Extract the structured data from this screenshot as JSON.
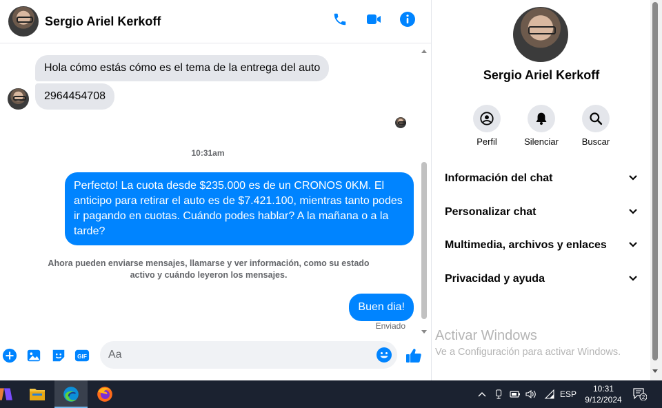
{
  "header": {
    "title": "Sergio Ariel Kerkoff"
  },
  "messages": {
    "incoming_1": "Hola cómo estás cómo es el tema de la entrega del auto",
    "incoming_2": "2964454708",
    "timestamp": "10:31am",
    "outgoing_1": "Perfecto! La cuota desde $235.000 es de un CRONOS 0KM. El anticipo para retirar el auto es de $7.421.100, mientras tanto podes ir pagando en cuotas. Cuándo podes hablar? A la mañana o a la tarde?",
    "notice": "Ahora pueden enviarse mensajes, llamarse y ver información, como su estado activo y cuándo leyeron los mensajes.",
    "outgoing_2": "Buen dia!",
    "status": "Enviado"
  },
  "composer": {
    "placeholder": "Aa",
    "value": ""
  },
  "side": {
    "name": "Sergio Ariel Kerkoff",
    "actions": [
      {
        "label": "Perfil",
        "icon": "profile-icon"
      },
      {
        "label": "Silenciar",
        "icon": "bell-icon"
      },
      {
        "label": "Buscar",
        "icon": "search-icon"
      }
    ],
    "menu": [
      "Información del chat",
      "Personalizar chat",
      "Multimedia, archivos y enlaces",
      "Privacidad y ayuda"
    ],
    "watermark_title": "Activar Windows",
    "watermark_sub": "Ve a Configuración para activar Windows."
  },
  "taskbar": {
    "time": "10:31",
    "date": "9/12/2024",
    "lang": "ESP",
    "notifications": "2"
  },
  "colors": {
    "accent": "#0084ff",
    "bubble_in": "#e4e6eb",
    "text_secondary": "#65676b",
    "taskbar": "#1b2230"
  }
}
